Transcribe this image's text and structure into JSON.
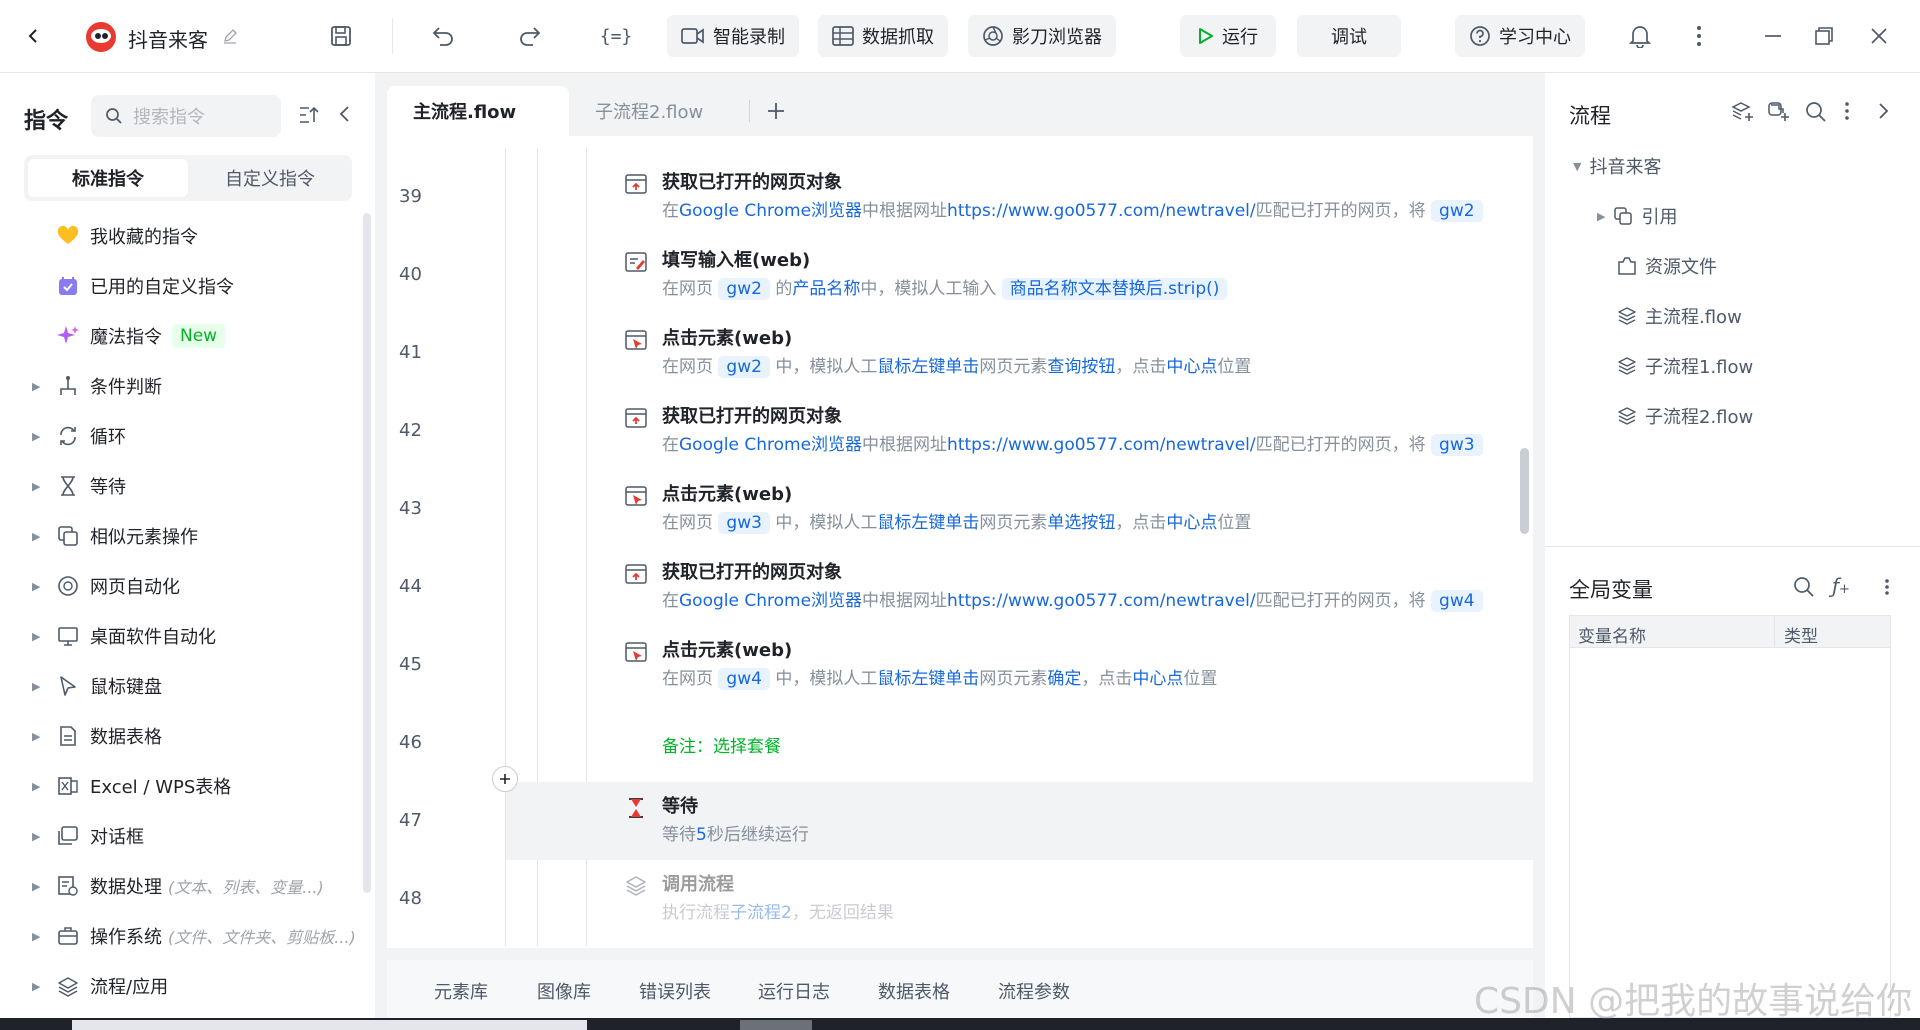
{
  "app": {
    "project_name": "抖音来客",
    "toolbar": {
      "smart_record": "智能录制",
      "data_capture": "数据抓取",
      "browser": "影刀浏览器",
      "run": "运行",
      "debug": "调试",
      "learning_center": "学习中心"
    }
  },
  "left_panel": {
    "title": "指令",
    "search_placeholder": "搜索指令",
    "tabs": [
      "标准指令",
      "自定义指令"
    ],
    "items": [
      {
        "label": "我收藏的指令",
        "icon": "heart-icon"
      },
      {
        "label": "已用的自定义指令",
        "icon": "calendar-check-icon"
      },
      {
        "label": "魔法指令",
        "icon": "magic-sparkle-icon",
        "badge": "New"
      },
      {
        "label": "条件判断",
        "icon": "branch-icon"
      },
      {
        "label": "循环",
        "icon": "loop-icon"
      },
      {
        "label": "等待",
        "icon": "hourglass-icon"
      },
      {
        "label": "相似元素操作",
        "icon": "copy-icon"
      },
      {
        "label": "网页自动化",
        "icon": "browser-icon"
      },
      {
        "label": "桌面软件自动化",
        "icon": "monitor-icon"
      },
      {
        "label": "鼠标键盘",
        "icon": "cursor-icon"
      },
      {
        "label": "数据表格",
        "icon": "document-icon"
      },
      {
        "label": "Excel / WPS表格",
        "icon": "excel-icon"
      },
      {
        "label": "对话框",
        "icon": "dialog-icon"
      },
      {
        "label": "数据处理",
        "icon": "data-process-icon",
        "hint": "(文本、列表、变量...)"
      },
      {
        "label": "操作系统",
        "icon": "toolbox-icon",
        "hint": "(文件、文件夹、剪贴板...)"
      },
      {
        "label": "流程/应用",
        "icon": "layers-icon"
      }
    ]
  },
  "editor": {
    "tabs": [
      "主流程.flow",
      "子流程2.flow"
    ],
    "line_numbers": [
      "39",
      "40",
      "41",
      "42",
      "43",
      "44",
      "45",
      "46",
      "47",
      "48"
    ],
    "steps": {
      "s39": {
        "title": "获取已打开的网页对象",
        "d1": "在",
        "d2": "Google Chrome浏览器",
        "d3": "中根据网址",
        "d4": "https://www.go0577.com/newtravel/",
        "d5": "匹配已打开的网页，将",
        "d6": "gw2"
      },
      "s40": {
        "title": "填写输入框(web)",
        "d1": "在网页",
        "d2": "gw2",
        "d3": "的",
        "d4": "产品名称",
        "d5": "中，模拟人工输入",
        "d6": "商品名称文本替换后.strip()"
      },
      "s41": {
        "title": "点击元素(web)",
        "d1": "在网页",
        "d2": "gw2",
        "d3": "中，模拟人工",
        "d4": "鼠标左键单击",
        "d5": "网页元素",
        "d6": "查询按钮",
        "d7": "，点击",
        "d8": "中心点",
        "d9": "位置"
      },
      "s42": {
        "title": "获取已打开的网页对象",
        "d1": "在",
        "d2": "Google Chrome浏览器",
        "d3": "中根据网址",
        "d4": "https://www.go0577.com/newtravel/",
        "d5": "匹配已打开的网页，将",
        "d6": "gw3"
      },
      "s43": {
        "title": "点击元素(web)",
        "d1": "在网页",
        "d2": "gw3",
        "d3": "中，模拟人工",
        "d4": "鼠标左键单击",
        "d5": "网页元素",
        "d6": "单选按钮",
        "d7": "，点击",
        "d8": "中心点",
        "d9": "位置"
      },
      "s44": {
        "title": "获取已打开的网页对象",
        "d1": "在",
        "d2": "Google Chrome浏览器",
        "d3": "中根据网址",
        "d4": "https://www.go0577.com/newtravel/",
        "d5": "匹配已打开的网页，将",
        "d6": "gw4"
      },
      "s45": {
        "title": "点击元素(web)",
        "d1": "在网页",
        "d2": "gw4",
        "d3": "中，模拟人工",
        "d4": "鼠标左键单击",
        "d5": "网页元素",
        "d6": "确定",
        "d7": "，点击",
        "d8": "中心点",
        "d9": "位置"
      },
      "s46": {
        "comment": "备注：选择套餐"
      },
      "s47": {
        "title": "等待",
        "d1": "等待",
        "d2": "5",
        "d3": "秒后继续运行"
      },
      "s48": {
        "title": "调用流程",
        "d1": "执行流程",
        "d2": "子流程2",
        "d3": "，无返回结果"
      }
    }
  },
  "bottom_tabs": [
    "元素库",
    "图像库",
    "错误列表",
    "运行日志",
    "数据表格",
    "流程参数"
  ],
  "right_panel": {
    "flow_title": "流程",
    "tree": {
      "root": "抖音来客",
      "ref": "引用",
      "resources": "资源文件",
      "main": "主流程.flow",
      "sub1": "子流程1.flow",
      "sub2": "子流程2.flow"
    },
    "globals_title": "全局变量",
    "columns": [
      "变量名称",
      "类型"
    ]
  },
  "watermark": "CSDN @把我的故事说给你"
}
